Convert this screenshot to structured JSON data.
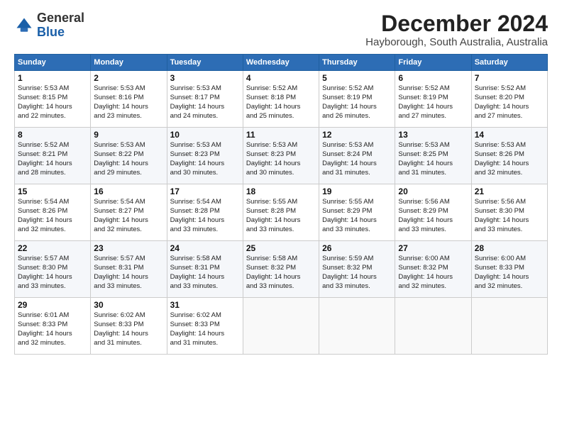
{
  "logo": {
    "general": "General",
    "blue": "Blue"
  },
  "header": {
    "month_year": "December 2024",
    "location": "Hayborough, South Australia, Australia"
  },
  "days_of_week": [
    "Sunday",
    "Monday",
    "Tuesday",
    "Wednesday",
    "Thursday",
    "Friday",
    "Saturday"
  ],
  "weeks": [
    [
      {
        "day": "1",
        "info": "Sunrise: 5:53 AM\nSunset: 8:15 PM\nDaylight: 14 hours\nand 22 minutes."
      },
      {
        "day": "2",
        "info": "Sunrise: 5:53 AM\nSunset: 8:16 PM\nDaylight: 14 hours\nand 23 minutes."
      },
      {
        "day": "3",
        "info": "Sunrise: 5:53 AM\nSunset: 8:17 PM\nDaylight: 14 hours\nand 24 minutes."
      },
      {
        "day": "4",
        "info": "Sunrise: 5:52 AM\nSunset: 8:18 PM\nDaylight: 14 hours\nand 25 minutes."
      },
      {
        "day": "5",
        "info": "Sunrise: 5:52 AM\nSunset: 8:19 PM\nDaylight: 14 hours\nand 26 minutes."
      },
      {
        "day": "6",
        "info": "Sunrise: 5:52 AM\nSunset: 8:19 PM\nDaylight: 14 hours\nand 27 minutes."
      },
      {
        "day": "7",
        "info": "Sunrise: 5:52 AM\nSunset: 8:20 PM\nDaylight: 14 hours\nand 27 minutes."
      }
    ],
    [
      {
        "day": "8",
        "info": "Sunrise: 5:52 AM\nSunset: 8:21 PM\nDaylight: 14 hours\nand 28 minutes."
      },
      {
        "day": "9",
        "info": "Sunrise: 5:53 AM\nSunset: 8:22 PM\nDaylight: 14 hours\nand 29 minutes."
      },
      {
        "day": "10",
        "info": "Sunrise: 5:53 AM\nSunset: 8:23 PM\nDaylight: 14 hours\nand 30 minutes."
      },
      {
        "day": "11",
        "info": "Sunrise: 5:53 AM\nSunset: 8:23 PM\nDaylight: 14 hours\nand 30 minutes."
      },
      {
        "day": "12",
        "info": "Sunrise: 5:53 AM\nSunset: 8:24 PM\nDaylight: 14 hours\nand 31 minutes."
      },
      {
        "day": "13",
        "info": "Sunrise: 5:53 AM\nSunset: 8:25 PM\nDaylight: 14 hours\nand 31 minutes."
      },
      {
        "day": "14",
        "info": "Sunrise: 5:53 AM\nSunset: 8:26 PM\nDaylight: 14 hours\nand 32 minutes."
      }
    ],
    [
      {
        "day": "15",
        "info": "Sunrise: 5:54 AM\nSunset: 8:26 PM\nDaylight: 14 hours\nand 32 minutes."
      },
      {
        "day": "16",
        "info": "Sunrise: 5:54 AM\nSunset: 8:27 PM\nDaylight: 14 hours\nand 32 minutes."
      },
      {
        "day": "17",
        "info": "Sunrise: 5:54 AM\nSunset: 8:28 PM\nDaylight: 14 hours\nand 33 minutes."
      },
      {
        "day": "18",
        "info": "Sunrise: 5:55 AM\nSunset: 8:28 PM\nDaylight: 14 hours\nand 33 minutes."
      },
      {
        "day": "19",
        "info": "Sunrise: 5:55 AM\nSunset: 8:29 PM\nDaylight: 14 hours\nand 33 minutes."
      },
      {
        "day": "20",
        "info": "Sunrise: 5:56 AM\nSunset: 8:29 PM\nDaylight: 14 hours\nand 33 minutes."
      },
      {
        "day": "21",
        "info": "Sunrise: 5:56 AM\nSunset: 8:30 PM\nDaylight: 14 hours\nand 33 minutes."
      }
    ],
    [
      {
        "day": "22",
        "info": "Sunrise: 5:57 AM\nSunset: 8:30 PM\nDaylight: 14 hours\nand 33 minutes."
      },
      {
        "day": "23",
        "info": "Sunrise: 5:57 AM\nSunset: 8:31 PM\nDaylight: 14 hours\nand 33 minutes."
      },
      {
        "day": "24",
        "info": "Sunrise: 5:58 AM\nSunset: 8:31 PM\nDaylight: 14 hours\nand 33 minutes."
      },
      {
        "day": "25",
        "info": "Sunrise: 5:58 AM\nSunset: 8:32 PM\nDaylight: 14 hours\nand 33 minutes."
      },
      {
        "day": "26",
        "info": "Sunrise: 5:59 AM\nSunset: 8:32 PM\nDaylight: 14 hours\nand 33 minutes."
      },
      {
        "day": "27",
        "info": "Sunrise: 6:00 AM\nSunset: 8:32 PM\nDaylight: 14 hours\nand 32 minutes."
      },
      {
        "day": "28",
        "info": "Sunrise: 6:00 AM\nSunset: 8:33 PM\nDaylight: 14 hours\nand 32 minutes."
      }
    ],
    [
      {
        "day": "29",
        "info": "Sunrise: 6:01 AM\nSunset: 8:33 PM\nDaylight: 14 hours\nand 32 minutes."
      },
      {
        "day": "30",
        "info": "Sunrise: 6:02 AM\nSunset: 8:33 PM\nDaylight: 14 hours\nand 31 minutes."
      },
      {
        "day": "31",
        "info": "Sunrise: 6:02 AM\nSunset: 8:33 PM\nDaylight: 14 hours\nand 31 minutes."
      },
      null,
      null,
      null,
      null
    ]
  ]
}
